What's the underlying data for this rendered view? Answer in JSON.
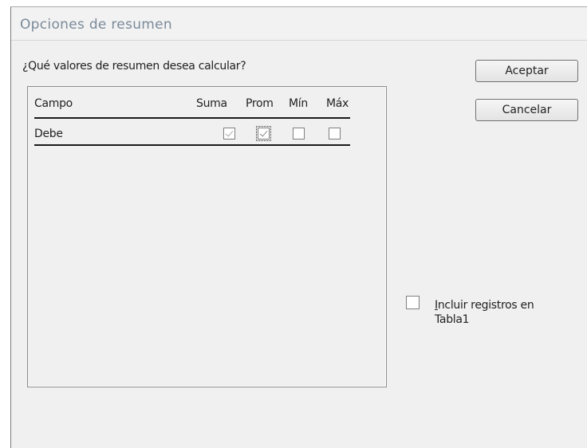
{
  "window": {
    "title": "Opciones de resumen"
  },
  "dialog": {
    "question": "¿Qué valores de resumen desea calcular?",
    "columns": {
      "field": "Campo",
      "sum": "Suma",
      "avg": "Prom",
      "min": "Mín",
      "max": "Máx"
    },
    "rows": [
      {
        "field": "Debe",
        "sum_checked": true,
        "avg_checked": true,
        "min_checked": false,
        "max_checked": false
      }
    ]
  },
  "buttons": {
    "accept": "Aceptar",
    "cancel": "Cancelar"
  },
  "include": {
    "label_mnemonic": "I",
    "label_rest": "ncluir registros en",
    "label_line2": "Tabla1",
    "checked": false
  }
}
